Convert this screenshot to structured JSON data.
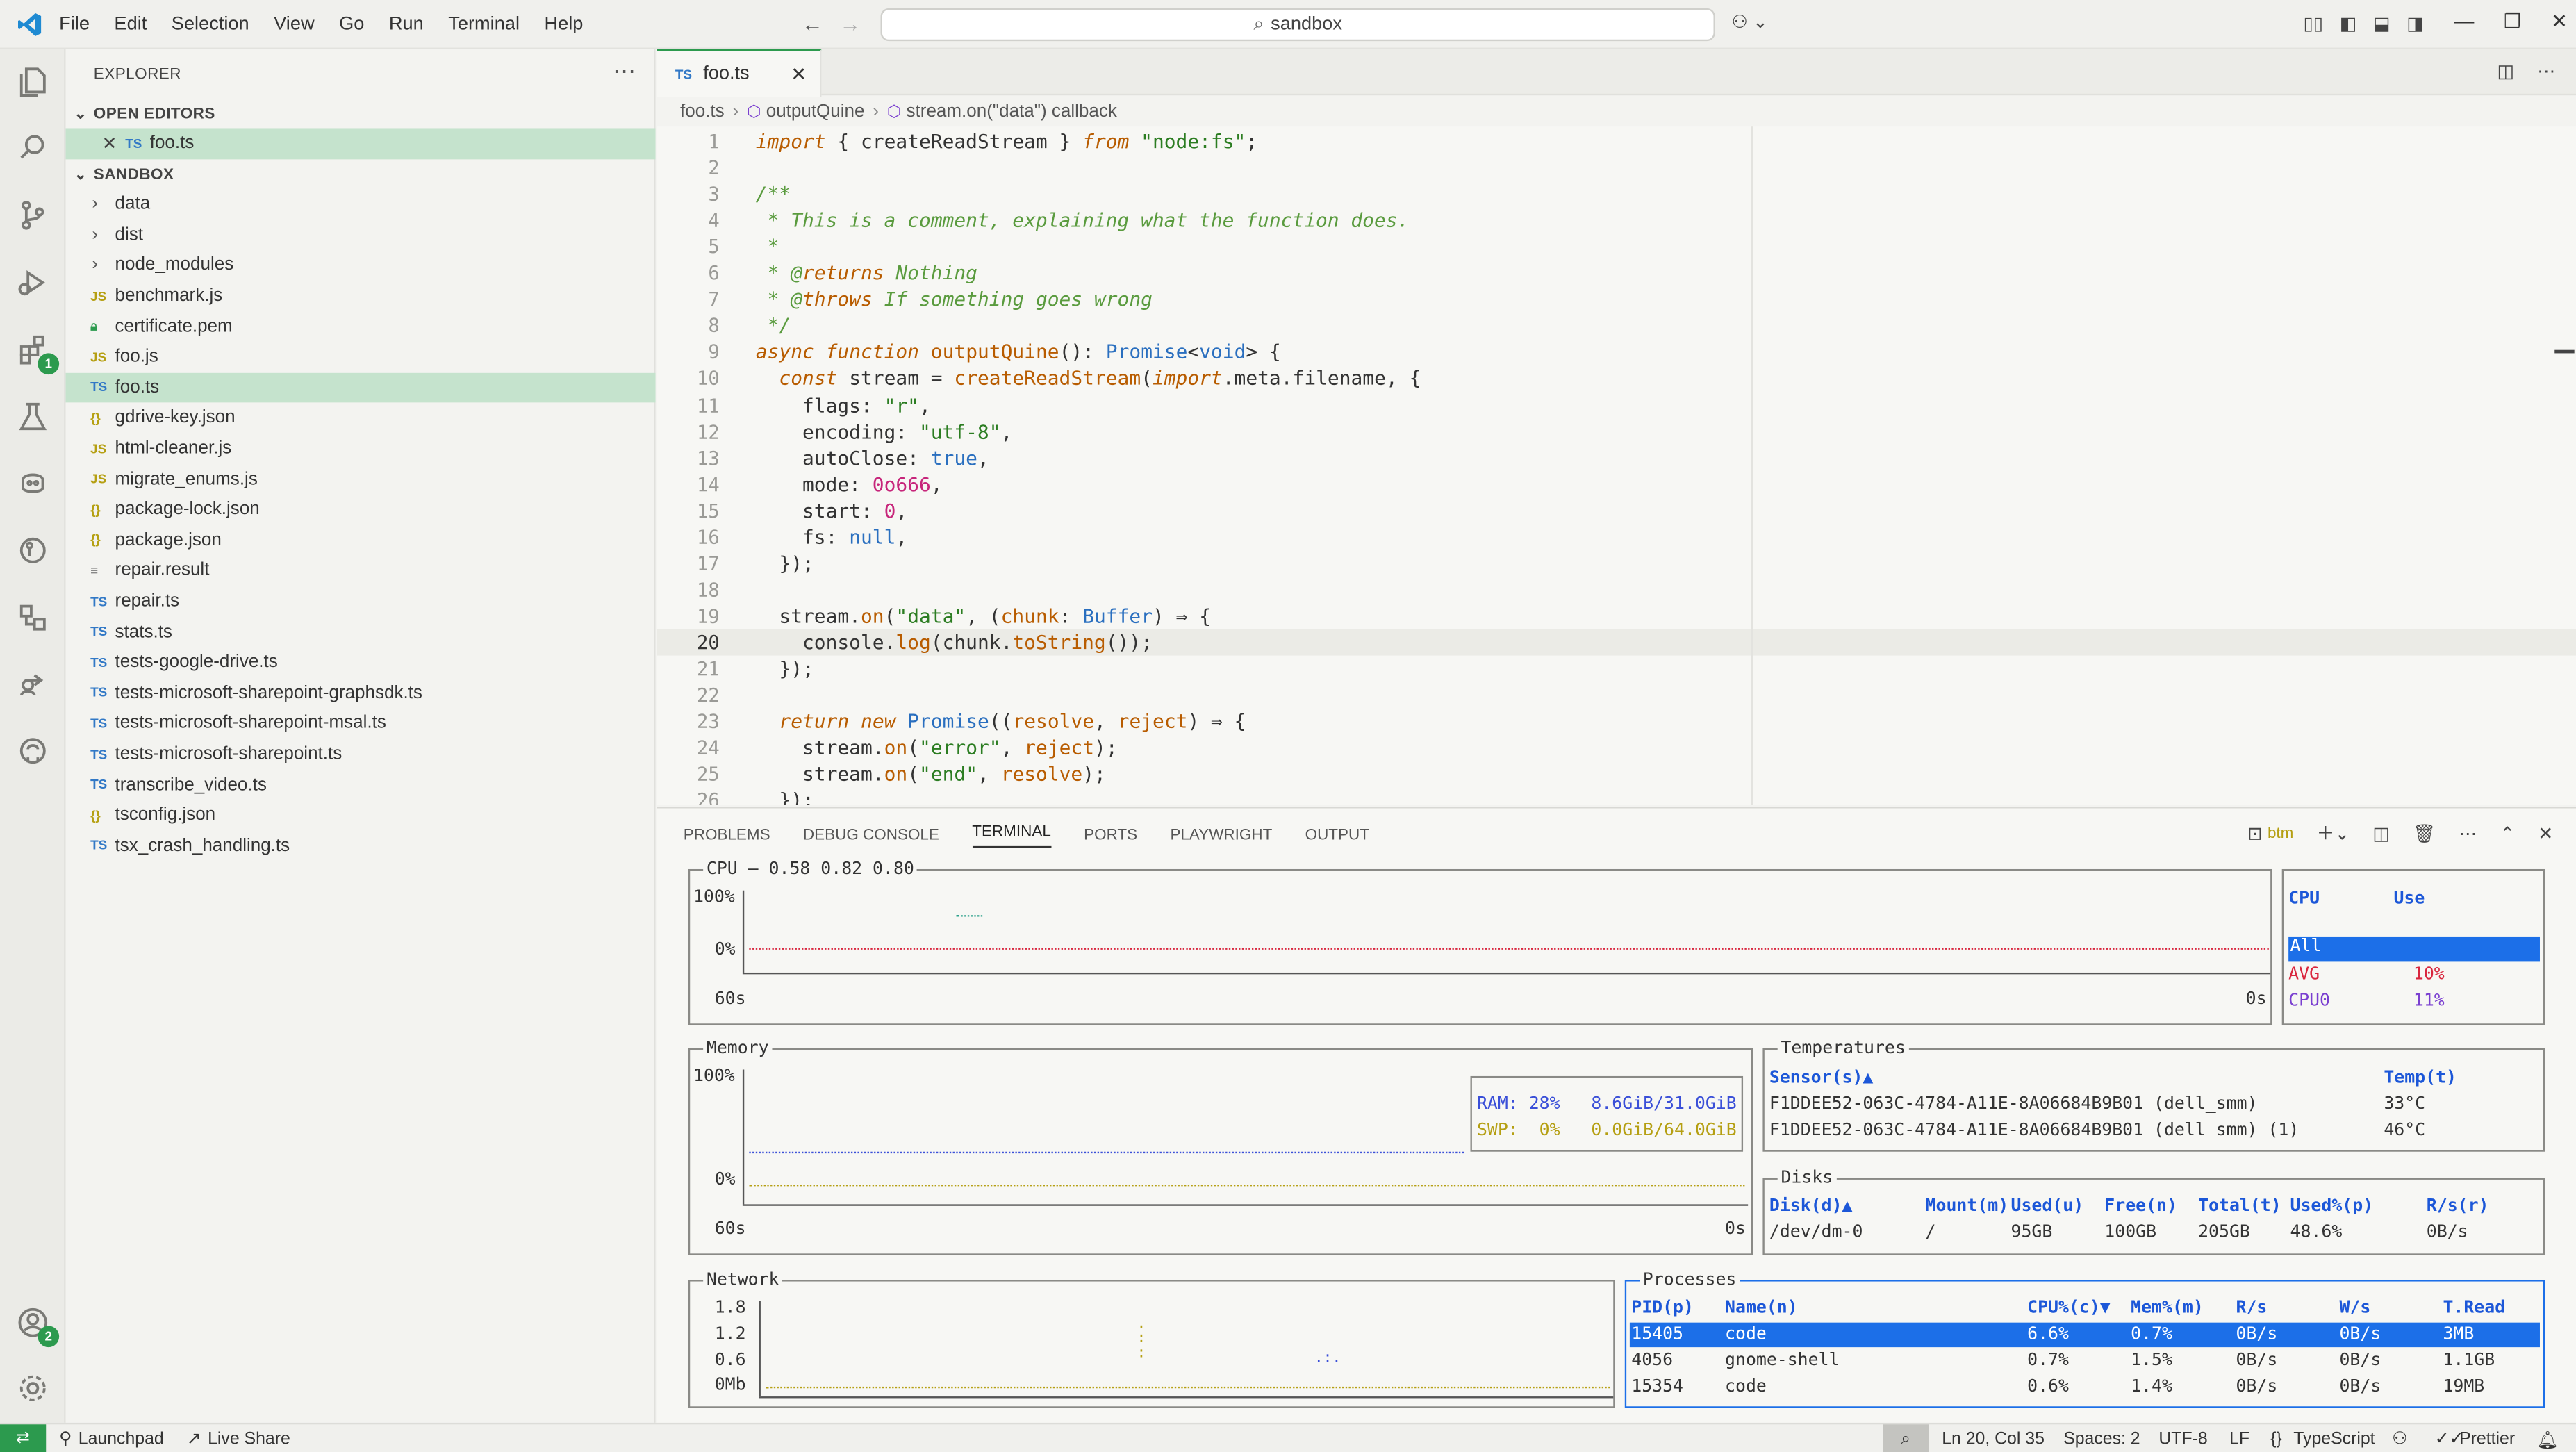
{
  "titlebar": {
    "menus": [
      "File",
      "Edit",
      "Selection",
      "View",
      "Go",
      "Run",
      "Terminal",
      "Help"
    ],
    "search": "sandbox"
  },
  "sidebar": {
    "title": "EXPLORER",
    "open_editors_label": "OPEN EDITORS",
    "open_editor": "foo.ts",
    "workspace_label": "SANDBOX",
    "folders": [
      "data",
      "dist",
      "node_modules"
    ],
    "files": [
      {
        "name": "benchmark.js",
        "type": "js"
      },
      {
        "name": "certificate.pem",
        "type": "lock"
      },
      {
        "name": "foo.js",
        "type": "js"
      },
      {
        "name": "foo.ts",
        "type": "ts"
      },
      {
        "name": "gdrive-key.json",
        "type": "json"
      },
      {
        "name": "html-cleaner.js",
        "type": "js"
      },
      {
        "name": "migrate_enums.js",
        "type": "js"
      },
      {
        "name": "package-lock.json",
        "type": "json"
      },
      {
        "name": "package.json",
        "type": "json"
      },
      {
        "name": "repair.result",
        "type": "res"
      },
      {
        "name": "repair.ts",
        "type": "ts"
      },
      {
        "name": "stats.ts",
        "type": "ts"
      },
      {
        "name": "tests-google-drive.ts",
        "type": "ts"
      },
      {
        "name": "tests-microsoft-sharepoint-graphsdk.ts",
        "type": "ts"
      },
      {
        "name": "tests-microsoft-sharepoint-msal.ts",
        "type": "ts"
      },
      {
        "name": "tests-microsoft-sharepoint.ts",
        "type": "ts"
      },
      {
        "name": "transcribe_video.ts",
        "type": "ts"
      },
      {
        "name": "tsconfig.json",
        "type": "json"
      },
      {
        "name": "tsx_crash_handling.ts",
        "type": "ts"
      }
    ]
  },
  "activity": {
    "extensions_badge": "1",
    "accounts_badge": "2"
  },
  "editor": {
    "tab": "foo.ts",
    "breadcrumb": [
      "foo.ts",
      "outputQuine",
      "stream.on(\"data\") callback"
    ],
    "active_line": "20",
    "lines": [
      [
        {
          "t": "import",
          "c": "kw"
        },
        {
          "t": " { createReadStream } "
        },
        {
          "t": "from",
          "c": "kw"
        },
        {
          "t": " "
        },
        {
          "t": "\"node:fs\"",
          "c": "st"
        },
        {
          "t": ";"
        }
      ],
      [],
      [
        {
          "t": "/**",
          "c": "cm"
        }
      ],
      [
        {
          "t": " * This is a comment, explaining what the function does.",
          "c": "cm"
        }
      ],
      [
        {
          "t": " *",
          "c": "cm"
        }
      ],
      [
        {
          "t": " * @",
          "c": "cm"
        },
        {
          "t": "returns",
          "c": "kw"
        },
        {
          "t": " Nothing",
          "c": "cm"
        }
      ],
      [
        {
          "t": " * @",
          "c": "cm"
        },
        {
          "t": "throws",
          "c": "kw"
        },
        {
          "t": " If something goes wrong",
          "c": "cm"
        }
      ],
      [
        {
          "t": " */",
          "c": "cm"
        }
      ],
      [
        {
          "t": "async",
          "c": "kw"
        },
        {
          "t": " "
        },
        {
          "t": "function",
          "c": "kw"
        },
        {
          "t": " "
        },
        {
          "t": "outputQuine",
          "c": "fn"
        },
        {
          "t": "(): "
        },
        {
          "t": "Promise",
          "c": "ty"
        },
        {
          "t": "<"
        },
        {
          "t": "void",
          "c": "ty"
        },
        {
          "t": "> {"
        }
      ],
      [
        {
          "t": "  "
        },
        {
          "t": "const",
          "c": "kw"
        },
        {
          "t": " stream = "
        },
        {
          "t": "createReadStream",
          "c": "fn"
        },
        {
          "t": "("
        },
        {
          "t": "import",
          "c": "kw"
        },
        {
          "t": ".meta.filename, {"
        }
      ],
      [
        {
          "t": "    flags: "
        },
        {
          "t": "\"r\"",
          "c": "st"
        },
        {
          "t": ","
        }
      ],
      [
        {
          "t": "    encoding: "
        },
        {
          "t": "\"utf-8\"",
          "c": "st"
        },
        {
          "t": ","
        }
      ],
      [
        {
          "t": "    autoClose: "
        },
        {
          "t": "true",
          "c": "ty"
        },
        {
          "t": ","
        }
      ],
      [
        {
          "t": "    mode: "
        },
        {
          "t": "0o666",
          "c": "nu"
        },
        {
          "t": ","
        }
      ],
      [
        {
          "t": "    start: "
        },
        {
          "t": "0",
          "c": "nu"
        },
        {
          "t": ","
        }
      ],
      [
        {
          "t": "    fs: "
        },
        {
          "t": "null",
          "c": "ty"
        },
        {
          "t": ","
        }
      ],
      [
        {
          "t": "  });"
        }
      ],
      [],
      [
        {
          "t": "  stream."
        },
        {
          "t": "on",
          "c": "fn"
        },
        {
          "t": "("
        },
        {
          "t": "\"data\"",
          "c": "st"
        },
        {
          "t": ", ("
        },
        {
          "t": "chunk",
          "c": "pa"
        },
        {
          "t": ": "
        },
        {
          "t": "Buffer",
          "c": "ty"
        },
        {
          "t": ") ⇒ {"
        }
      ],
      [
        {
          "t": "    console."
        },
        {
          "t": "log",
          "c": "fn"
        },
        {
          "t": "(chunk."
        },
        {
          "t": "toString",
          "c": "fn"
        },
        {
          "t": "());"
        }
      ],
      [
        {
          "t": "  });"
        }
      ],
      [],
      [
        {
          "t": "  "
        },
        {
          "t": "return",
          "c": "kw"
        },
        {
          "t": " "
        },
        {
          "t": "new",
          "c": "kw"
        },
        {
          "t": " "
        },
        {
          "t": "Promise",
          "c": "ty"
        },
        {
          "t": "(("
        },
        {
          "t": "resolve",
          "c": "pa"
        },
        {
          "t": ", "
        },
        {
          "t": "reject",
          "c": "pa"
        },
        {
          "t": ") ⇒ {"
        }
      ],
      [
        {
          "t": "    stream."
        },
        {
          "t": "on",
          "c": "fn"
        },
        {
          "t": "("
        },
        {
          "t": "\"error\"",
          "c": "st"
        },
        {
          "t": ", "
        },
        {
          "t": "reject",
          "c": "pa"
        },
        {
          "t": ");"
        }
      ],
      [
        {
          "t": "    stream."
        },
        {
          "t": "on",
          "c": "fn"
        },
        {
          "t": "("
        },
        {
          "t": "\"end\"",
          "c": "st"
        },
        {
          "t": ", "
        },
        {
          "t": "resolve",
          "c": "pa"
        },
        {
          "t": ");"
        }
      ],
      [
        {
          "t": "  });"
        }
      ]
    ]
  },
  "panel": {
    "tabs": [
      "PROBLEMS",
      "DEBUG CONSOLE",
      "TERMINAL",
      "PORTS",
      "PLAYWRIGHT",
      "OUTPUT"
    ],
    "active_tab": "TERMINAL",
    "terminal_name": "btm",
    "cpu": {
      "title": "CPU — 0.58 0.82 0.80",
      "y_top": "100%",
      "y_bot": "0%",
      "x_left": "60s",
      "x_right": "0s",
      "legend_header": [
        "CPU",
        "Use"
      ],
      "legend": [
        [
          "All",
          ""
        ],
        [
          "AVG",
          "10%"
        ],
        [
          "CPU0",
          "11%"
        ]
      ]
    },
    "memory": {
      "title": "Memory",
      "y_top": "100%",
      "y_bot": "0%",
      "x_left": "60s",
      "x_right": "0s",
      "ram": "RAM: 28%   8.6GiB/31.0GiB",
      "swp": "SWP:  0%   0.0GiB/64.0GiB"
    },
    "temps": {
      "title": "Temperatures",
      "headers": [
        "Sensor(s)▲",
        "Temp(t)"
      ],
      "rows": [
        [
          "F1DDEE52-063C-4784-A11E-8A06684B9B01 (dell_smm)",
          "33°C"
        ],
        [
          "F1DDEE52-063C-4784-A11E-8A06684B9B01 (dell_smm) (1)",
          "46°C"
        ]
      ]
    },
    "disks": {
      "title": "Disks",
      "headers": [
        "Disk(d)▲",
        "Mount(m)",
        "Used(u)",
        "Free(n)",
        "Total(t)",
        "Used%(p)",
        "R/s(r)"
      ],
      "rows": [
        [
          "/dev/dm-0",
          "/",
          "95GB",
          "100GB",
          "205GB",
          "48.6%",
          "0B/s"
        ]
      ]
    },
    "network": {
      "title": "Network",
      "ticks": [
        "1.8",
        "1.2",
        "0.6",
        "0Mb"
      ]
    },
    "processes": {
      "title": "Processes",
      "headers": [
        "PID(p)",
        "Name(n)",
        "CPU%(c)▼",
        "Mem%(m)",
        "R/s",
        "W/s",
        "T.Read"
      ],
      "rows": [
        [
          "15405",
          "code",
          "6.6%",
          "0.7%",
          "0B/s",
          "0B/s",
          "3MB"
        ],
        [
          "4056",
          "gnome-shell",
          "0.7%",
          "1.5%",
          "0B/s",
          "0B/s",
          "1.1GB"
        ],
        [
          "15354",
          "code",
          "0.6%",
          "1.4%",
          "0B/s",
          "0B/s",
          "19MB"
        ]
      ]
    }
  },
  "status": {
    "launchpad": "Launchpad",
    "liveshare": "Live Share",
    "position": "Ln 20, Col 35",
    "spaces": "Spaces: 2",
    "encoding": "UTF-8",
    "eol": "LF",
    "language": "TypeScript",
    "prettier": "Prettier"
  }
}
